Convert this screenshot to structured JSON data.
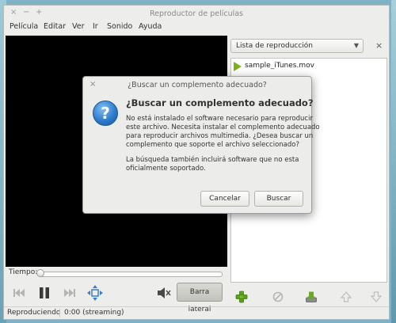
{
  "window": {
    "title": "Reproductor de películas",
    "controls": [
      "×",
      "−",
      "+"
    ]
  },
  "menu": {
    "items": [
      "Película",
      "Editar",
      "Ver",
      "Ir",
      "Sonido",
      "Ayuda"
    ]
  },
  "sidebar": {
    "selector_label": "Lista de reproducción",
    "close_glyph": "×",
    "playlist": [
      {
        "name": "sample_iTunes.mov"
      }
    ]
  },
  "playback": {
    "time_label": "Tiempo:",
    "seek_progress": 0,
    "sidebar_button": "Barra lateral"
  },
  "status": {
    "state": "Reproduciendo",
    "time": "0:00 (streaming)"
  },
  "dialog": {
    "title": "¿Buscar un complemento adecuado?",
    "close_glyph": "×",
    "icon_glyph": "?",
    "heading": "¿Buscar un complemento adecuado?",
    "paragraph1": [
      "No está instalado el software necesario para reproducir",
      "este archivo. Necesita instalar el complemento adecuado",
      "para reproducir archivos multimedia. ¿Desea buscar un",
      "complemento que soporte el archivo seleccionado?"
    ],
    "paragraph2": [
      "La búsqueda también incluirá software que no esta",
      "oficialmente soportado."
    ],
    "cancel_label": "Cancelar",
    "search_label": "Buscar"
  },
  "colors": {
    "play_accent": "#7ab21c",
    "add_accent": "#5aa01a",
    "info_blue": "#2a77c8"
  }
}
